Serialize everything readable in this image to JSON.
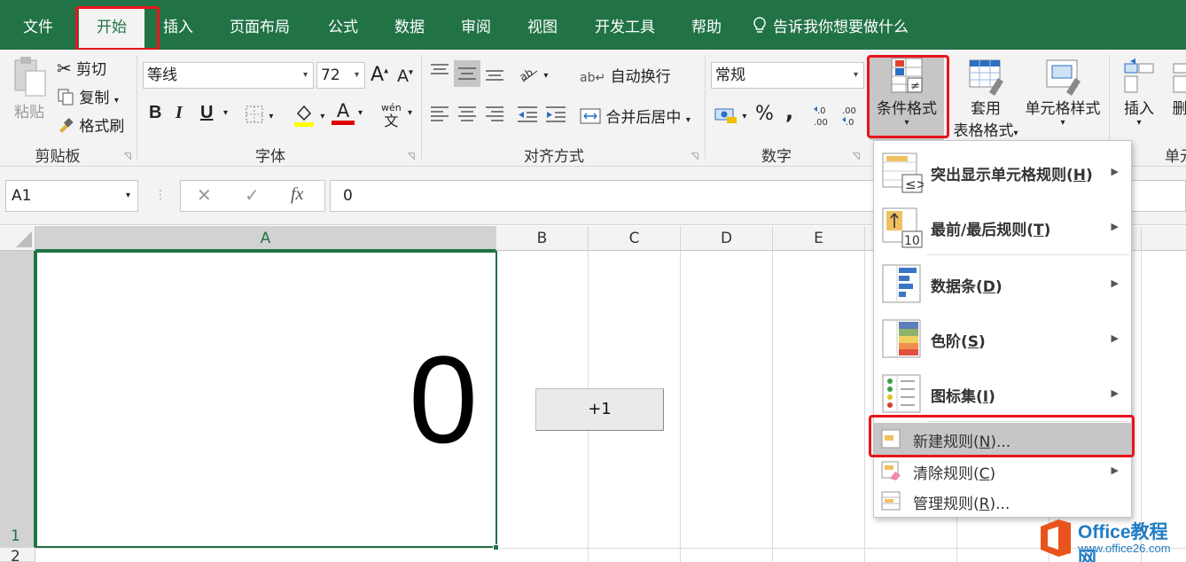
{
  "tabs": [
    "文件",
    "开始",
    "插入",
    "页面布局",
    "公式",
    "数据",
    "审阅",
    "视图",
    "开发工具",
    "帮助"
  ],
  "active_tab": "开始",
  "tell_me": "告诉我你想要做什么",
  "ribbon": {
    "clipboard": {
      "label": "剪贴板",
      "paste": "粘贴",
      "cut": "剪切",
      "copy": "复制",
      "format_painter": "格式刷"
    },
    "font": {
      "label": "字体",
      "name": "等线",
      "size": "72",
      "bold": "B",
      "italic": "I",
      "underline": "U",
      "grow": "A",
      "shrink": "A",
      "font_color": "A",
      "phonetic_top": "wén",
      "phonetic_bottom": "文"
    },
    "alignment": {
      "label": "对齐方式",
      "wrap": "自动换行",
      "merge": "合并后居中"
    },
    "number": {
      "label": "数字",
      "format": "常规",
      "percent": "%",
      "comma": ","
    },
    "styles": {
      "conditional": "条件格式",
      "table_line1": "套用",
      "table_line2": "表格格式",
      "cell_styles": "单元格样式"
    },
    "cells": {
      "insert": "插入",
      "delete": "删",
      "label": "单元"
    }
  },
  "formula_bar": {
    "name_box": "A1",
    "cancel": "✕",
    "enter": "✓",
    "fx": "fx",
    "value": "0"
  },
  "columns": [
    "A",
    "B",
    "C",
    "D",
    "E"
  ],
  "rows": [
    "1",
    "2"
  ],
  "cell_a1": "0",
  "plus_button": "+1",
  "cf_menu": {
    "highlight": {
      "text": "突出显示单元格规则(",
      "key": "H",
      "tail": ")"
    },
    "topbottom": {
      "text": "最前/最后规则(",
      "key": "T",
      "tail": ")"
    },
    "databar": {
      "text": "数据条(",
      "key": "D",
      "tail": ")"
    },
    "colorscale": {
      "text": "色阶(",
      "key": "S",
      "tail": ")"
    },
    "iconset": {
      "text": "图标集(",
      "key": "I",
      "tail": ")"
    },
    "new_rule": {
      "text": "新建规则(",
      "key": "N",
      "tail": ")..."
    },
    "clear_rule": {
      "text": "清除规则(",
      "key": "C",
      "tail": ")"
    },
    "manage_rule": {
      "text": "管理规则(",
      "key": "R",
      "tail": ")..."
    },
    "topbottom_badge": "10"
  },
  "watermark": {
    "name": "Office教程网",
    "url": "www.office26.com"
  },
  "colors": {
    "excel_green": "#217346",
    "highlight_red": "#e8141b",
    "font_yellow": "#ffff00",
    "font_red": "#e00000"
  }
}
